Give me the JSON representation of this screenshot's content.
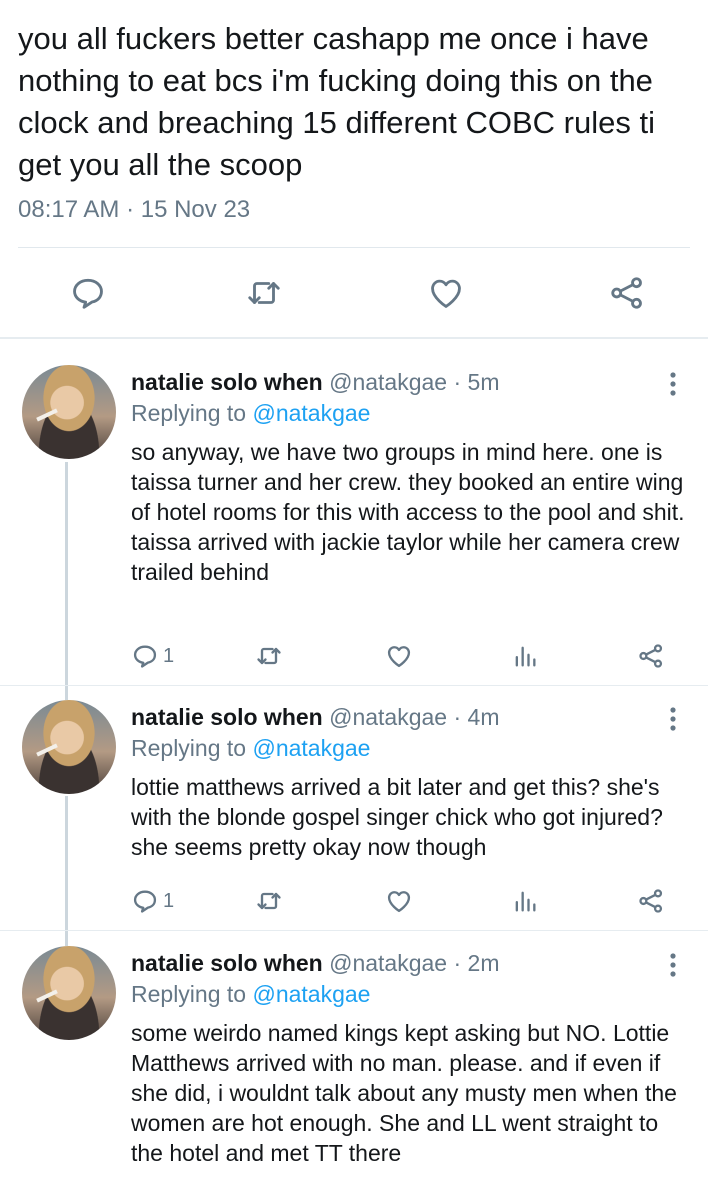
{
  "main_tweet": {
    "text": "you all fuckers better cashapp me once i have nothing to eat bcs i'm fucking doing this on the clock and breaching 15 different COBC rules ti get you all the scoop",
    "timestamp": "08:17 AM · 15 Nov 23"
  },
  "icons": {
    "reply": "reply-icon",
    "retweet": "retweet-icon",
    "like": "heart-icon",
    "share": "share-icon",
    "analytics": "analytics-icon",
    "more": "more-vertical-icon"
  },
  "colors": {
    "text": "#14171a",
    "secondary": "#657786",
    "link": "#1da1f2",
    "divider": "#e1e8ed"
  },
  "replies": [
    {
      "name": "natalie solo when",
      "handle": "@natakgae",
      "time": "· 5m",
      "replying_prefix": "Replying to",
      "replying_handle": "@natakgae",
      "text": "so anyway, we have two groups in mind here. one is taissa turner and her crew. they booked an entire wing of hotel rooms for this with access to the pool and shit. taissa arrived with jackie taylor while her camera crew trailed behind",
      "reply_count": "1"
    },
    {
      "name": "natalie solo when",
      "handle": "@natakgae",
      "time": "· 4m",
      "replying_prefix": "Replying to",
      "replying_handle": "@natakgae",
      "text": "lottie matthews arrived a bit later and get this? she's with the blonde gospel singer chick who got injured? she seems pretty okay now though",
      "reply_count": "1"
    },
    {
      "name": "natalie solo when",
      "handle": "@natakgae",
      "time": "· 2m",
      "replying_prefix": "Replying to",
      "replying_handle": "@natakgae",
      "text": "some weirdo named kings kept asking but NO. Lottie Matthews arrived with no man. please. and if even if she did, i wouldnt talk about any musty men when the women are hot enough. She and LL went straight to the hotel and met TT there"
    }
  ]
}
